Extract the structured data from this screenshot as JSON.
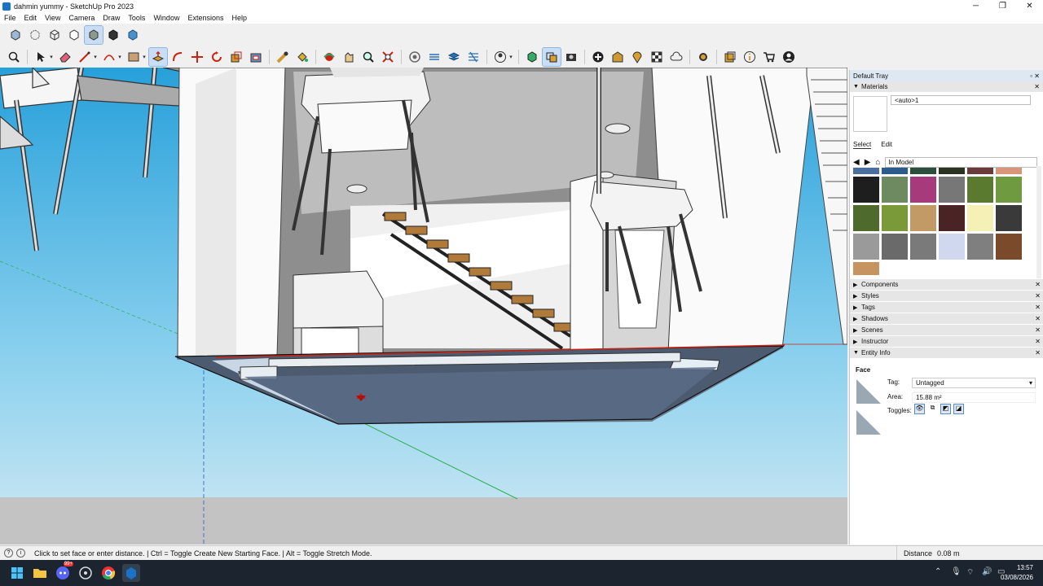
{
  "window": {
    "title": "dahmin yummy - SketchUp Pro 2023"
  },
  "menu": [
    "File",
    "Edit",
    "View",
    "Camera",
    "Draw",
    "Tools",
    "Window",
    "Extensions",
    "Help"
  ],
  "tray": {
    "title": "Default Tray",
    "materials": {
      "header": "Materials",
      "name_value": "<auto>1",
      "tab_select": "Select",
      "tab_edit": "Edit",
      "library": "In Model"
    },
    "sections": [
      "Components",
      "Styles",
      "Tags",
      "Shadows",
      "Scenes",
      "Instructor"
    ],
    "entity_info": {
      "header": "Entity Info",
      "type": "Face",
      "tag_label": "Tag:",
      "tag_value": "Untagged",
      "area_label": "Area:",
      "area_value": "15.88 m²",
      "toggles_label": "Toggles:"
    }
  },
  "status": {
    "message": "Click to set face or enter distance. | Ctrl = Toggle Create New Starting Face. | Alt = Toggle Stretch Mode.",
    "distance_label": "Distance",
    "distance_value": "0.08 m"
  },
  "clock": {
    "time": "13:57",
    "date": "03/08/2026"
  },
  "taskbar": {
    "discord_badge": "99+"
  },
  "swatch_colors": [
    "#4a6f9e",
    "#2c5a8a",
    "#2b4f3c",
    "#2a3322",
    "#6b3a3a",
    "#d8957a",
    "#1e1e1e",
    "#6e8a60",
    "#a63a7a",
    "#777777",
    "#5a7a30",
    "#6f9a40",
    "#4e6a2c",
    "#7a9a3a",
    "#c29a66",
    "#4a2424",
    "#f4f0b6",
    "#3a3a3a",
    "#9a9a9a",
    "#6a6a6a",
    "#7a7a7a",
    "#cfd8ee",
    "#7f7f7f",
    "#7a4a2a",
    "#c69460"
  ]
}
